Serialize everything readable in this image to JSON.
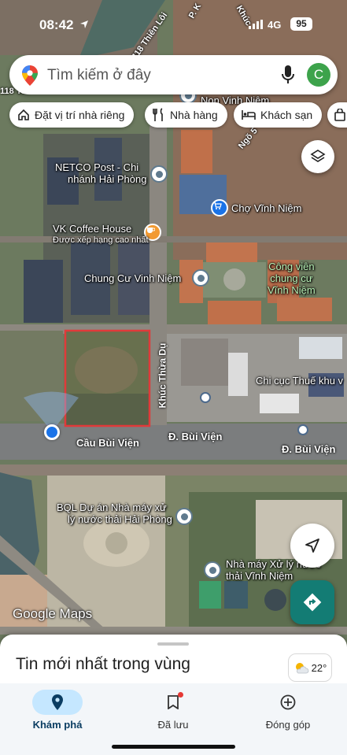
{
  "status_bar": {
    "time": "08:42",
    "network": "4G",
    "battery": "95"
  },
  "search": {
    "placeholder": "Tìm kiếm ở đây",
    "avatar_letter": "C"
  },
  "chips": [
    {
      "label": "Đặt vị trí nhà riêng",
      "icon": "home-icon"
    },
    {
      "label": "Nhà hàng",
      "icon": "restaurant-icon"
    },
    {
      "label": "Khách sạn",
      "icon": "hotel-icon"
    }
  ],
  "map_labels": {
    "netco_line1": "NETCO Post - Chi",
    "netco_line2": "nhánh Hải Phòng",
    "vk_coffee": "VK Coffee House",
    "vk_coffee_sub": "Được xếp hạng cao nhất",
    "chung_cu": "Chung Cư Vinh Niệm",
    "cho": "Chợ Vĩnh Niệm",
    "park_line1": "Công viên",
    "park_line2": "chung cư",
    "park_line3": "Vĩnh Niệm",
    "chi_cuc": "Chi cục Thuế khu v",
    "bql_line1": "BQL Dự án Nhà máy xử",
    "bql_line2": "lý nước thải Hải Phòng",
    "nha_may_line1": "Nhà máy Xử lý nước",
    "nha_may_line2": "thải Vĩnh Niệm",
    "non_vinh_niem": "Non Vinh Niệm",
    "road_418": "418 Thiên Lôi",
    "road_khuc_thua_du": "Khúc Thừa Dụ",
    "road_bui_vien_1": "Cầu Bùi Viện",
    "road_bui_vien_2": "Đ. Bùi Viện",
    "road_bui_vien_3": "Đ. Bùi Viện",
    "road_118": "118 Thi",
    "road_ngo": "Ngõ 5",
    "road_p": "P. K",
    "road_khuc": "Khúc"
  },
  "logo": "Google Maps",
  "sheet": {
    "title": "Tin mới nhất trong vùng",
    "weather": "22°"
  },
  "nav": [
    {
      "label": "Khám phá",
      "icon": "explore-pin-icon",
      "active": true
    },
    {
      "label": "Đã lưu",
      "icon": "bookmark-icon",
      "active": false
    },
    {
      "label": "Đóng góp",
      "icon": "add-circle-icon",
      "active": false
    }
  ],
  "colors": {
    "accent": "#137c74",
    "highlight_box": "#e03a3a",
    "active_nav": "#c5e7ff",
    "avatar": "#3da34b"
  }
}
